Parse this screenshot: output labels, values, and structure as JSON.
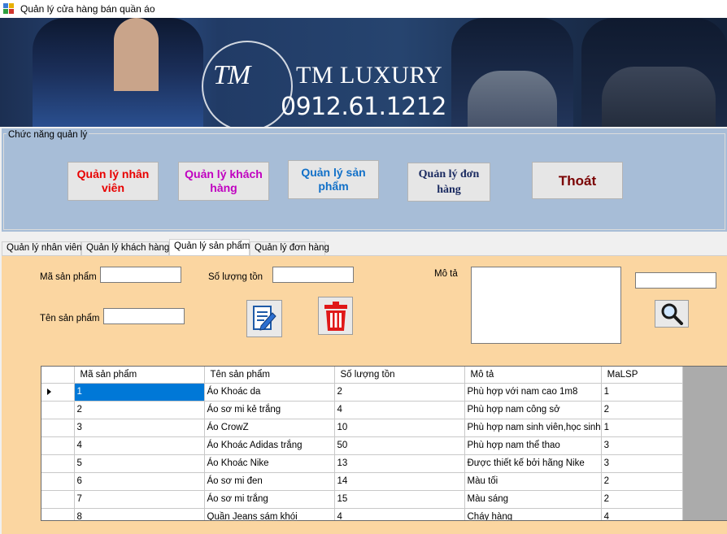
{
  "window": {
    "title": "Quản lý cửa hàng bán quần áo"
  },
  "banner": {
    "logo_mark": "TM",
    "brand": "TM LUXURY",
    "phone": "0912.61.1212"
  },
  "menu_group": {
    "legend": "Chức năng quản lý",
    "buttons": [
      {
        "label": "Quản lý nhân viên",
        "color": "#e80000"
      },
      {
        "label": "Quản lý khách hàng",
        "color": "#c000c0"
      },
      {
        "label": "Quản lý sản phẩm",
        "color": "#1170c8"
      },
      {
        "label": "Quản lý đơn hàng",
        "color": "#1a2a60"
      },
      {
        "label": "Thoát",
        "color": "#7a0000"
      }
    ]
  },
  "tabs": [
    {
      "label": "Quản lý nhân viên"
    },
    {
      "label": "Quản lý khách hàng"
    },
    {
      "label": "Quản lý sản phẩm",
      "active": true
    },
    {
      "label": "Quản lý đơn hàng"
    }
  ],
  "form": {
    "ma_sp_label": "Mã sản phẩm",
    "ten_sp_label": "Tên sản phẩm",
    "so_luong_label": "Số lượng tồn",
    "mo_ta_label": "Mô tả",
    "ma_sp_value": "",
    "ten_sp_value": "",
    "so_luong_value": "",
    "mo_ta_value": "",
    "search_value": "",
    "panel_color": "#fbd6a1"
  },
  "grid": {
    "columns": [
      "Mã sản phẩm",
      "Tên sản phẩm",
      "Số lượng tồn",
      "Mô tả",
      "MaLSP"
    ],
    "rows": [
      [
        "1",
        "Áo Khoác da",
        "2",
        "Phù hợp với nam cao 1m8",
        "1"
      ],
      [
        "2",
        "Áo sơ mi kẻ trắng",
        "4",
        "Phù hợp nam công sở",
        "2"
      ],
      [
        "3",
        "Áo CrowZ",
        "10",
        "Phù hợp nam sinh viên,học sinh",
        "1"
      ],
      [
        "4",
        "Áo Khoác Adidas trắng",
        "50",
        "Phù hợp nam thể thao",
        "3"
      ],
      [
        "5",
        "Áo Khoác Nike",
        "13",
        "Được thiết kế bởi hãng Nike",
        "3"
      ],
      [
        "6",
        "Áo sơ mi đen",
        "14",
        "Màu tối",
        "2"
      ],
      [
        "7",
        "Áo sơ mi trắng",
        "15",
        "Màu sáng",
        "2"
      ],
      [
        "8",
        "Quần Jeans sám khói",
        "4",
        "Cháy hàng",
        "4"
      ]
    ],
    "selected_row": 0
  }
}
